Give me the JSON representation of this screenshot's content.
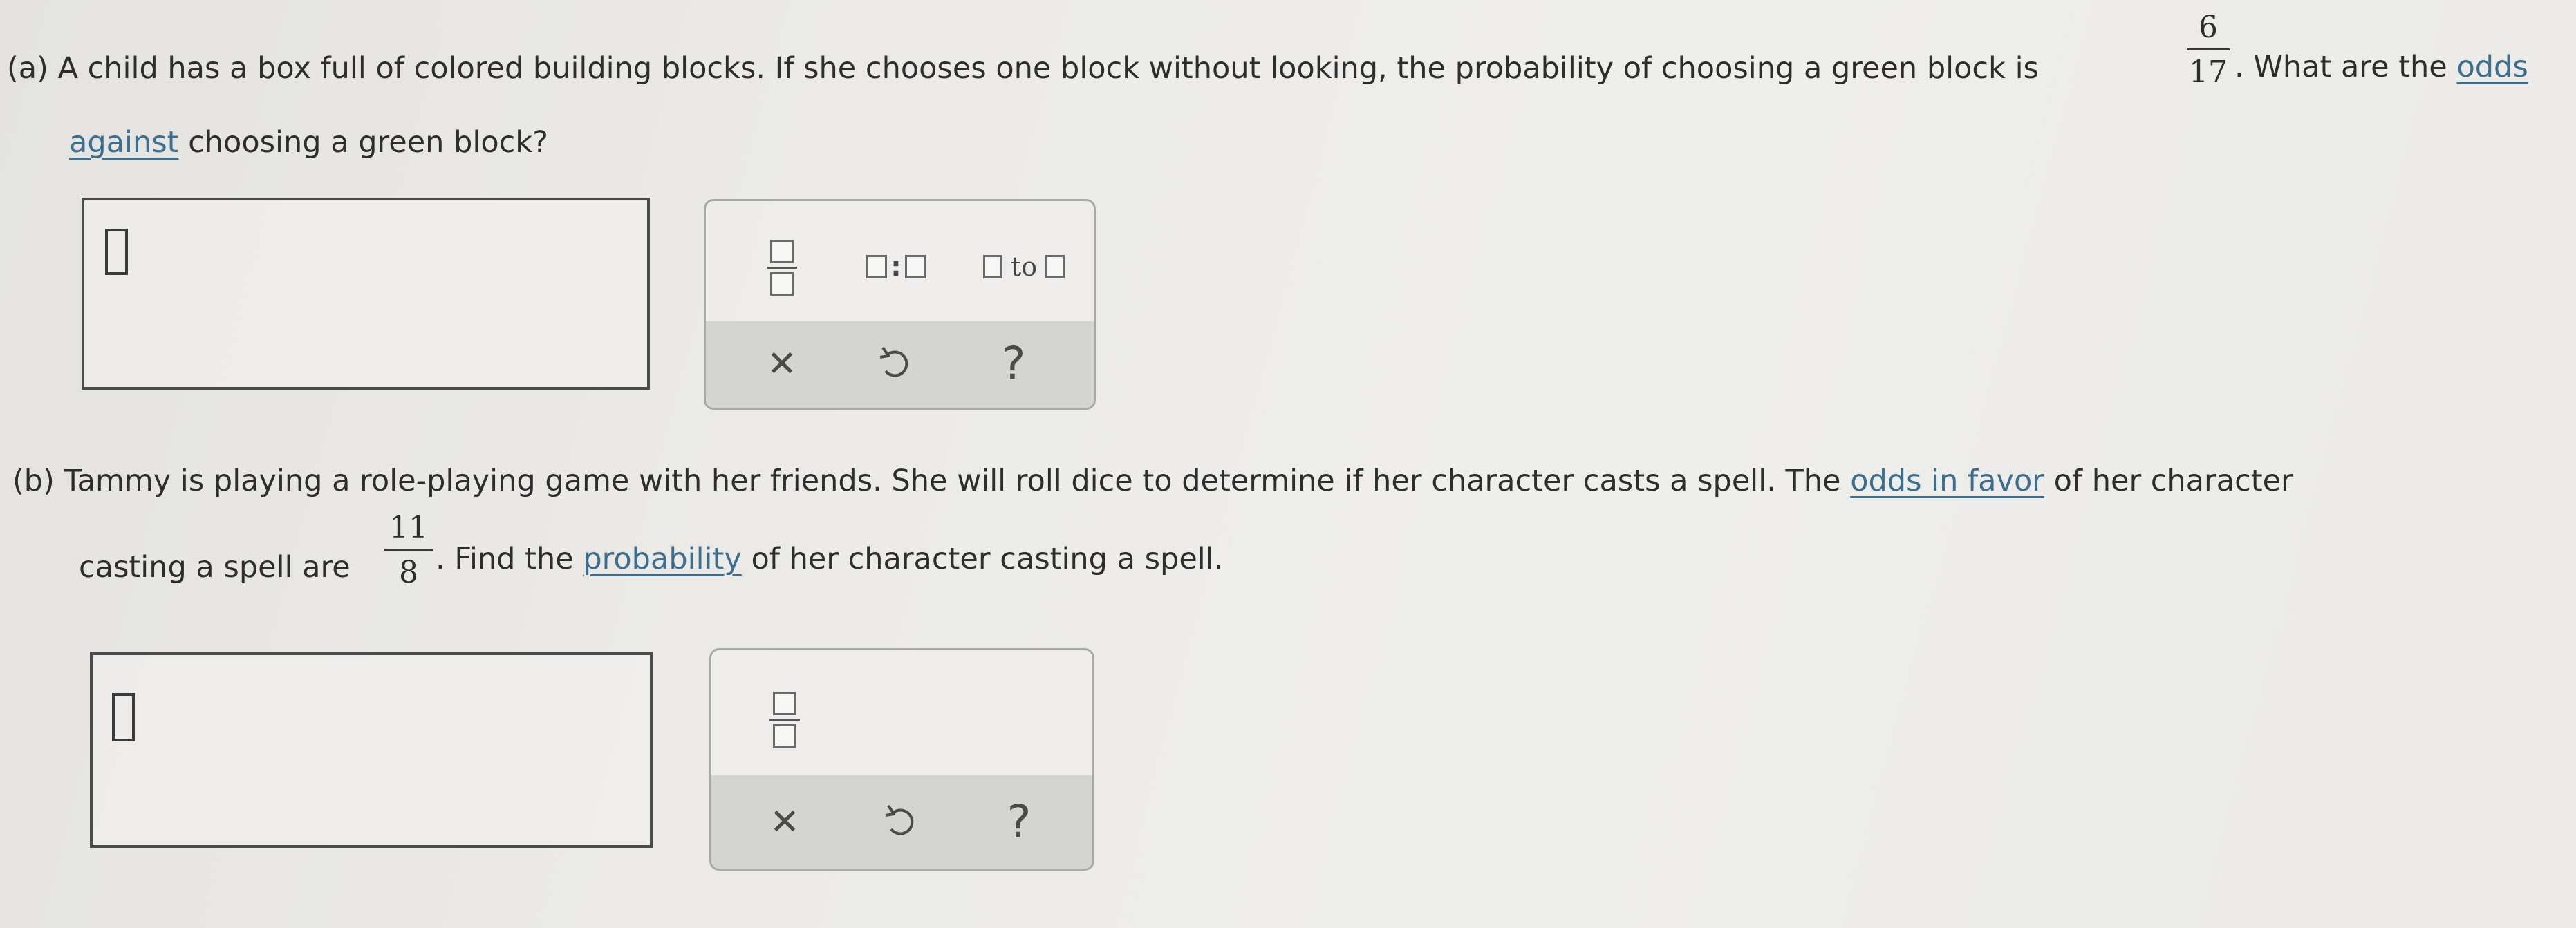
{
  "part_a": {
    "label": "(a)",
    "text_1": " A child has a box full of colored building blocks. If she chooses one block without looking, the probability of choosing a green block is",
    "fraction": {
      "numerator": "6",
      "denominator": "17"
    },
    "text_2": ". What are the ",
    "link_odds": "odds",
    "link_against": "against",
    "text_3": " choosing a green block?",
    "toolbar": {
      "fraction_icon": "fraction-template-icon",
      "ratio_icon": "ratio-template-icon",
      "ratio_colon": ":",
      "to_icon": "odds-to-template-icon",
      "to_word": "to",
      "clear_icon": "close-icon",
      "undo_icon": "undo-icon",
      "help_icon": "help-icon",
      "clear_glyph": "✕",
      "help_glyph": "?"
    }
  },
  "part_b": {
    "label": "(b)",
    "text_1": " Tammy is playing a role-playing game with her friends. She will roll dice to determine if her character casts a spell. The ",
    "link_odds_in_favor": "odds in favor",
    "text_2": " of her character",
    "text_3": "casting a spell are",
    "fraction": {
      "numerator": "11",
      "denominator": "8"
    },
    "text_4": ". Find the ",
    "link_probability": "probability",
    "text_5": " of her character casting a spell.",
    "toolbar": {
      "fraction_icon": "fraction-template-icon",
      "clear_icon": "close-icon",
      "undo_icon": "undo-icon",
      "help_icon": "help-icon",
      "clear_glyph": "✕",
      "help_glyph": "?"
    }
  },
  "colors": {
    "link": "#3b6f8f",
    "text": "#2d2d2d",
    "panel_bottom": "#d4d4d1"
  }
}
